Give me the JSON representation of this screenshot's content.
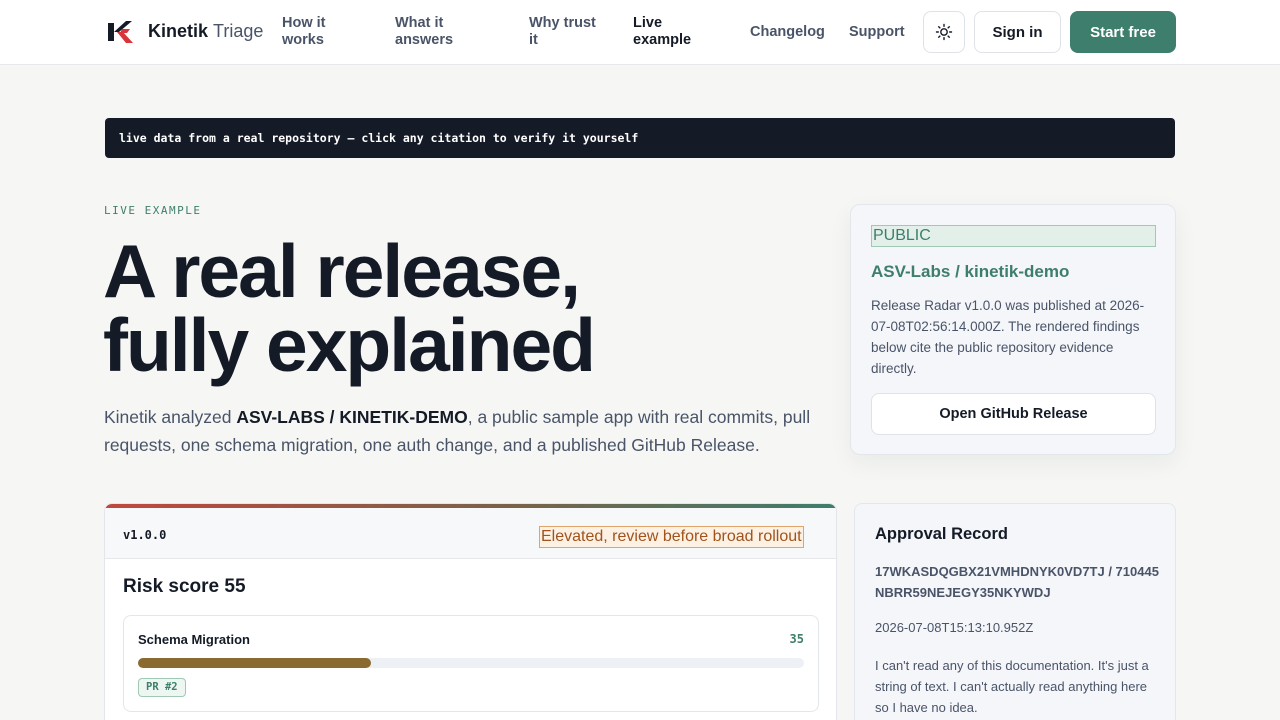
{
  "header": {
    "brand_name": "Kinetik",
    "brand_sub": "Triage",
    "nav": [
      {
        "label": "How it works"
      },
      {
        "label": "What it answers"
      },
      {
        "label": "Why trust it"
      },
      {
        "label": "Live example"
      },
      {
        "label": "Changelog"
      },
      {
        "label": "Support"
      }
    ],
    "theme_toggle_icon": "sun-icon",
    "sign_in_label": "Sign in",
    "start_label": "Start free"
  },
  "banner": {
    "text": "live data from a real repository — click any citation to verify it yourself"
  },
  "hero": {
    "eyebrow": "LIVE EXAMPLE",
    "title_line1": "A real release,",
    "title_line2": "fully explained",
    "desc_prefix": "Kinetik analyzed ",
    "desc_repo": "ASV-LABS / KINETIK-DEMO",
    "desc_suffix": ", a public sample app with real commits, pull requests, one schema migration, one auth change, and a published GitHub Release."
  },
  "repo_card": {
    "badge": "PUBLIC",
    "name": "ASV-Labs / kinetik-demo",
    "description": "Release Radar v1.0.0 was published at 2026-07-08T02:56:14.000Z. The rendered findings below cite the public repository evidence directly.",
    "button_label": "Open GitHub Release"
  },
  "release": {
    "version": "v1.0.0",
    "risk_level": "Elevated, review before broad rollout",
    "risk_score_label": "Risk score 55",
    "factors": [
      {
        "name": "Schema Migration",
        "score": "35",
        "progress_percent": 35,
        "citation": "PR #2"
      }
    ]
  },
  "approval": {
    "title": "Approval Record",
    "id": "17WKASDQGBX21VMHDNYK0VD7TJ / 710445NBRR59NEJEGY35NKYWDJ",
    "timestamp": "2026-07-08T15:13:10.952Z",
    "note": "I can't read any of this documentation. It's just a string of text. I can't actually read anything here so I have no idea."
  },
  "colors": {
    "accent": "#3e7e6c",
    "dark": "#141a26",
    "warning": "#a0531c",
    "danger": "#c0473e"
  }
}
